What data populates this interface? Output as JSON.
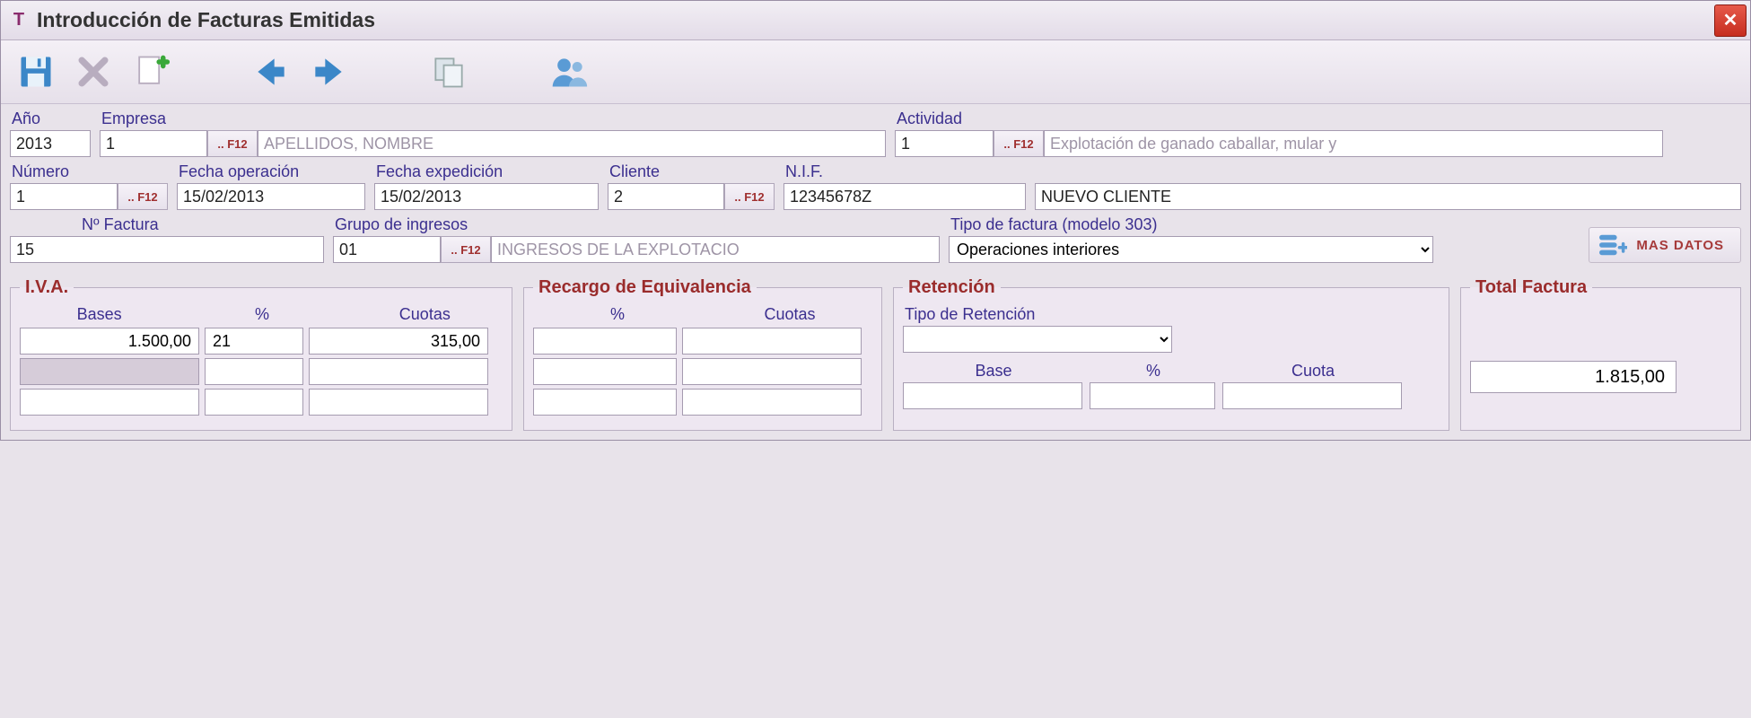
{
  "window": {
    "title": "Introducción de Facturas Emitidas",
    "close_tooltip": "Cerrar"
  },
  "toolbar": {
    "save_name": "save-icon",
    "delete_name": "delete-icon",
    "new_name": "new-document-icon",
    "prev_name": "arrow-left-icon",
    "next_name": "arrow-right-icon",
    "copy_name": "copy-icon",
    "client_name": "clients-icon"
  },
  "labels": {
    "ano": "Año",
    "empresa": "Empresa",
    "actividad": "Actividad",
    "numero": "Número",
    "fecha_operacion": "Fecha operación",
    "fecha_expedicion": "Fecha expedición",
    "cliente": "Cliente",
    "nif": "N.I.F.",
    "n_factura": "Nº Factura",
    "grupo_ingresos": "Grupo de ingresos",
    "tipo_factura": "Tipo de factura (modelo 303)",
    "mas_datos": "MAS DATOS",
    "f12": ".. F12"
  },
  "form": {
    "ano": "2013",
    "empresa_code": "1",
    "empresa_name": "APELLIDOS, NOMBRE",
    "actividad_code": "1",
    "actividad_name": "Explotación de ganado caballar, mular y",
    "numero": "1",
    "fecha_operacion": "15/02/2013",
    "fecha_expedicion": "15/02/2013",
    "cliente_code": "2",
    "nif": "12345678Z",
    "cliente_name": "NUEVO CLIENTE",
    "n_factura": "15",
    "grupo_ingresos_code": "01",
    "grupo_ingresos_name": "INGRESOS DE LA EXPLOTACIO",
    "tipo_factura_selected": "Operaciones interiores"
  },
  "iva": {
    "legend": "I.V.A.",
    "col_bases": "Bases",
    "col_pct": "%",
    "col_cuotas": "Cuotas",
    "rows": [
      {
        "base": "1.500,00",
        "pct": "21",
        "cuota": "315,00"
      },
      {
        "base": "",
        "pct": "",
        "cuota": ""
      },
      {
        "base": "",
        "pct": "",
        "cuota": ""
      }
    ]
  },
  "recargo": {
    "legend": "Recargo de Equivalencia",
    "col_pct": "%",
    "col_cuotas": "Cuotas",
    "rows": [
      {
        "pct": "",
        "cuota": ""
      },
      {
        "pct": "",
        "cuota": ""
      },
      {
        "pct": "",
        "cuota": ""
      }
    ]
  },
  "retencion": {
    "legend": "Retención",
    "tipo_label": "Tipo de Retención",
    "tipo_value": "",
    "col_base": "Base",
    "col_pct": "%",
    "col_cuota": "Cuota",
    "base": "",
    "pct": "",
    "cuota": ""
  },
  "total": {
    "legend": "Total Factura",
    "value": "1.815,00"
  }
}
